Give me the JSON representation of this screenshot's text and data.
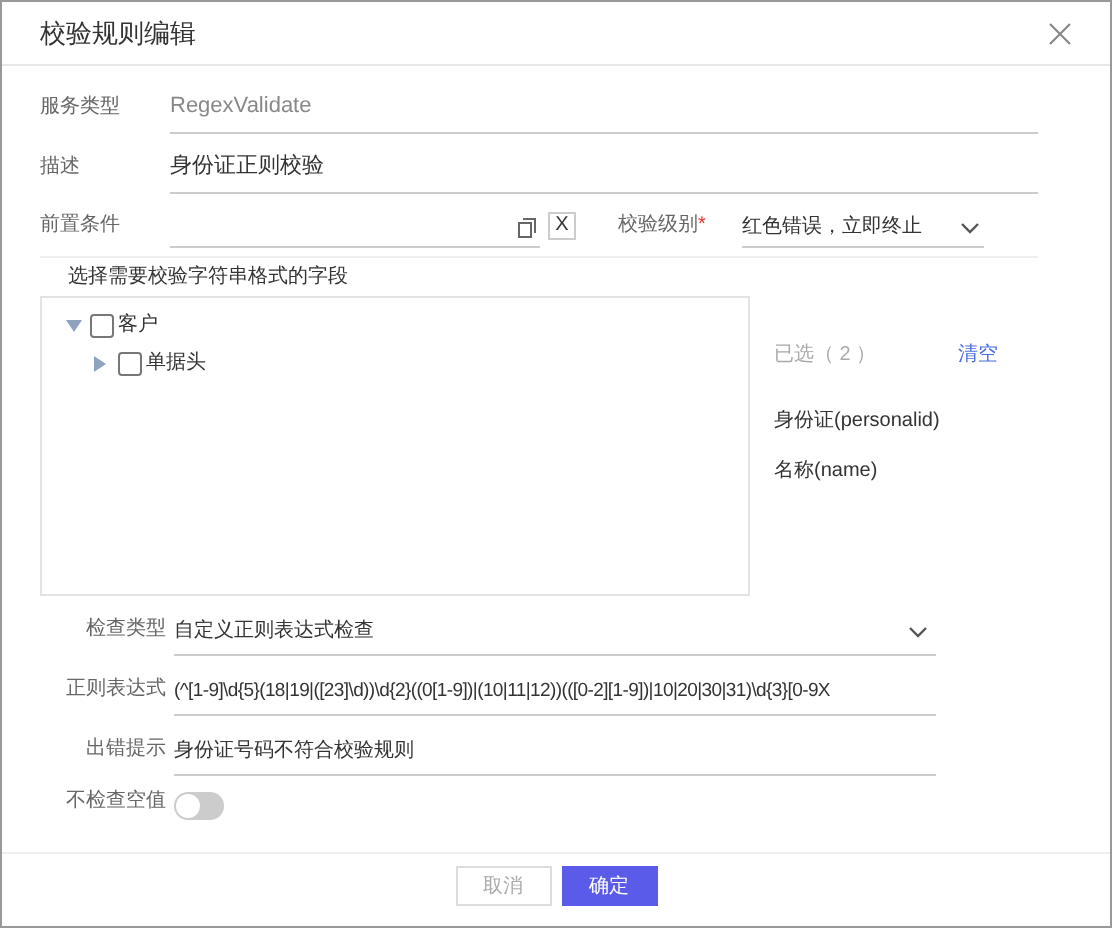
{
  "dialog": {
    "title": "校验规则编辑"
  },
  "fields": [
    {
      "label": "服务类型",
      "value": "RegexValidate",
      "disabled": true
    },
    {
      "label": "描述",
      "value": "身份证正则校验",
      "disabled": false
    }
  ],
  "precondition": {
    "label": "前置条件",
    "clear_button": "X"
  },
  "level_select": {
    "label": "校验级别",
    "required_mark": "*",
    "value": "红色错误，立即终止"
  },
  "field_picker": {
    "title": "选择需要校验字符串格式的字段",
    "tree": [
      {
        "label": "客户",
        "checked": false,
        "expanded": true,
        "children": [
          {
            "label": "单据头",
            "checked": false,
            "expanded": false
          }
        ]
      }
    ],
    "selected_count": "已选（ 2 ）",
    "clear_link": "清空",
    "selected": [
      "身份证(personalid)",
      "名称(name)"
    ]
  },
  "check_type": {
    "label": "检查类型",
    "value": "自定义正则表达式检查"
  },
  "regex": {
    "label": "正则表达式",
    "value": "(^[1-9]\\d{5}(18|19|([23]\\d))\\d{2}((0[1-9])|(10|11|12))(([0-2][1-9])|10|20|30|31)\\d{3}[0-9X"
  },
  "error_hint": {
    "label": "出错提示",
    "value": "身份证号码不符合校验规则"
  },
  "skip_empty": {
    "label": "不检查空值",
    "on": false
  },
  "buttons": [
    {
      "label": "取消",
      "kind": "secondary"
    },
    {
      "label": "确定",
      "kind": "primary"
    }
  ]
}
